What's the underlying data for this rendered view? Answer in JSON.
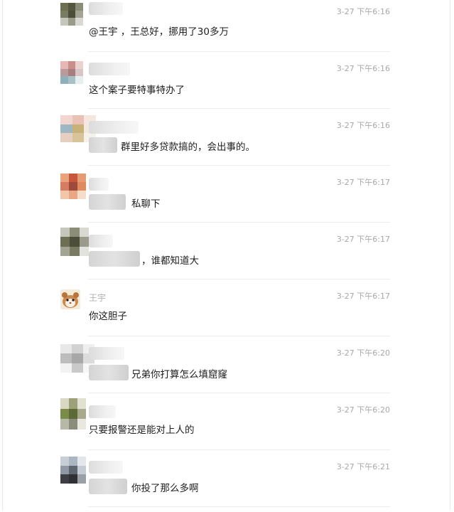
{
  "messages": [
    {
      "name": "",
      "time": "3-27 下午6:16",
      "text": "@王宇 ，王总好，挪用了30多万"
    },
    {
      "name": "",
      "time": "3-27 下午6:16",
      "text": "这个案子要特事特办了"
    },
    {
      "name": "",
      "time": "3-27 下午6:16",
      "text": "群里好多贷款搞的，会出事的。"
    },
    {
      "name": "",
      "time": "3-27 下午6:17",
      "text": "私聊下"
    },
    {
      "name": "",
      "time": "3-27 下午6:17",
      "text": "，谁都知道大"
    },
    {
      "name": "王宇",
      "time": "3-27 下午6:17",
      "text": "你这胆子"
    },
    {
      "name": "",
      "time": "3-27 下午6:20",
      "text": "兄弟你打算怎么填窟窿"
    },
    {
      "name": "",
      "time": "3-27 下午6:20",
      "text": "只要报警还是能对上人的"
    },
    {
      "name": "",
      "time": "3-27 下午6:21",
      "text": "你投了那么多啊"
    }
  ]
}
